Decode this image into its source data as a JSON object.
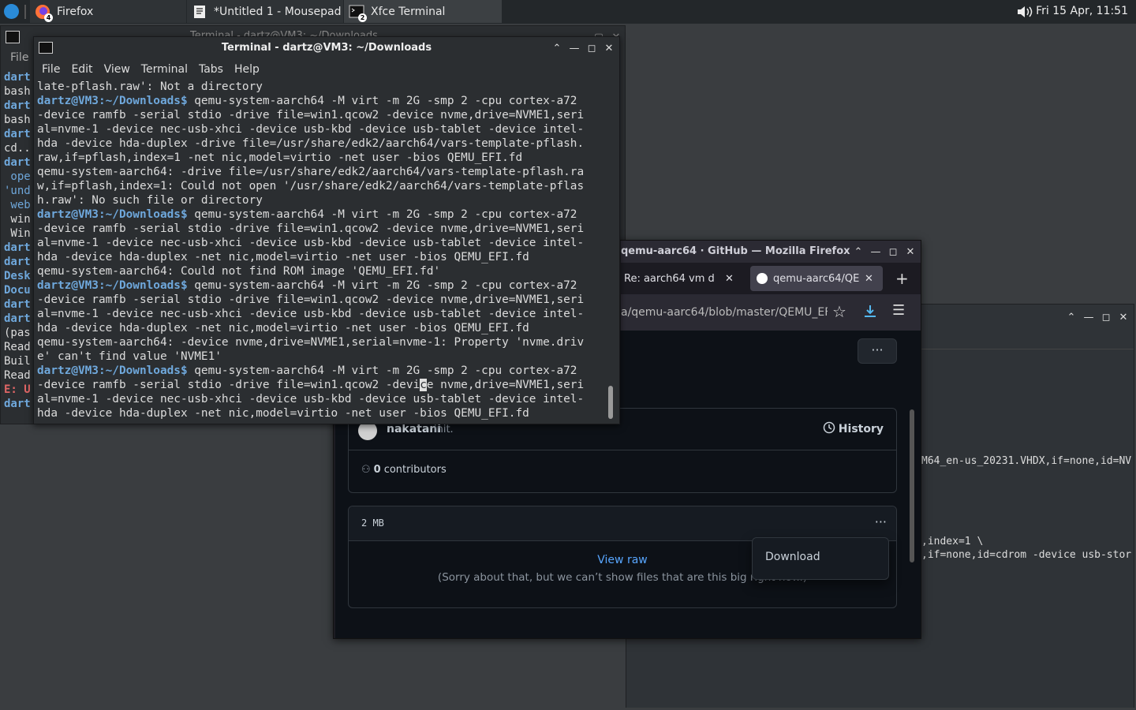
{
  "panel": {
    "tasks": [
      {
        "label": "Firefox",
        "badge": "4"
      },
      {
        "label": "*Untitled 1 - Mousepad",
        "badge": ""
      },
      {
        "label": "Xfce Terminal",
        "badge": "2"
      }
    ],
    "clock": "Fri 15 Apr, 11:51"
  },
  "back_terminal": {
    "title": "Terminal - dartz@VM3: ~/Downloads",
    "menu_first": "File",
    "side_lines": [
      "dart",
      "bash",
      "dart",
      "bash",
      "dart",
      "cd..",
      "dart",
      " ope",
      "'und",
      " web",
      " win",
      " Win",
      "dart",
      "dart",
      "Desk",
      "Docu",
      "dart",
      "dart",
      "(pas",
      "Read",
      "Buil",
      "Read",
      "E: U",
      "dart"
    ]
  },
  "terminal": {
    "title": "Terminal - dartz@VM3: ~/Downloads",
    "menu": [
      "File",
      "Edit",
      "View",
      "Terminal",
      "Tabs",
      "Help"
    ],
    "prompt": "dartz@VM3:~/Downloads$",
    "lines": [
      {
        "t": "late-pflash.raw': Not a directory"
      },
      {
        "p": true,
        "t": " qemu-system-aarch64 -M virt -m 2G -smp 2 -cpu cortex-a72"
      },
      {
        "t": "-device ramfb -serial stdio -drive file=win1.qcow2 -device nvme,drive=NVME1,seri"
      },
      {
        "t": "al=nvme-1 -device nec-usb-xhci -device usb-kbd -device usb-tablet -device intel-"
      },
      {
        "t": "hda -device hda-duplex -drive file=/usr/share/edk2/aarch64/vars-template-pflash."
      },
      {
        "t": "raw,if=pflash,index=1 -net nic,model=virtio -net user -bios QEMU_EFI.fd"
      },
      {
        "t": "qemu-system-aarch64: -drive file=/usr/share/edk2/aarch64/vars-template-pflash.ra"
      },
      {
        "t": "w,if=pflash,index=1: Could not open '/usr/share/edk2/aarch64/vars-template-pflas"
      },
      {
        "t": "h.raw': No such file or directory"
      },
      {
        "p": true,
        "t": " qemu-system-aarch64 -M virt -m 2G -smp 2 -cpu cortex-a72"
      },
      {
        "t": "-device ramfb -serial stdio -drive file=win1.qcow2 -device nvme,drive=NVME1,seri"
      },
      {
        "t": "al=nvme-1 -device nec-usb-xhci -device usb-kbd -device usb-tablet -device intel-"
      },
      {
        "t": "hda -device hda-duplex -net nic,model=virtio -net user -bios QEMU_EFI.fd"
      },
      {
        "t": "qemu-system-aarch64: Could not find ROM image 'QEMU_EFI.fd'"
      },
      {
        "p": true,
        "t": " qemu-system-aarch64 -M virt -m 2G -smp 2 -cpu cortex-a72"
      },
      {
        "t": "-device ramfb -serial stdio -drive file=win1.qcow2 -device nvme,drive=NVME1,seri"
      },
      {
        "t": "al=nvme-1 -device nec-usb-xhci -device usb-kbd -device usb-tablet -device intel-"
      },
      {
        "t": "hda -device hda-duplex -net nic,model=virtio -net user -bios QEMU_EFI.fd"
      },
      {
        "t": "qemu-system-aarch64: -device nvme,drive=NVME1,serial=nvme-1: Property 'nvme.driv"
      },
      {
        "t": "e' can't find value 'NVME1'"
      },
      {
        "p": true,
        "t": " qemu-system-aarch64 -M virt -m 2G -smp 2 -cpu cortex-a72"
      },
      {
        "t": "-device ramfb -serial stdio -drive file=win1.qcow2 -devi",
        "cursor": "c",
        "after": "e nvme,drive=NVME1,seri"
      },
      {
        "t": "al=nvme-1 -device nec-usb-xhci -device usb-kbd -device usb-tablet -device intel-"
      },
      {
        "t": "hda -device hda-duplex -net nic,model=virtio -net user -bios QEMU_EFI.fd"
      }
    ]
  },
  "firefox": {
    "title": "qemu-aarc64 · GitHub — Mozilla Firefox",
    "tabs": [
      {
        "label": "Re: aarch64 vm d"
      },
      {
        "label": "qemu-aarc64/QE"
      }
    ],
    "url": "a/qemu-aarc64/blob/master/QEMU_EF",
    "commit": {
      "author": "nakatani",
      "message": "init.",
      "history": "History"
    },
    "contributors": {
      "count": "0",
      "label": "contributors"
    },
    "file": {
      "size": "2 MB",
      "view_raw": "View raw",
      "note": "(Sorry about that, but we can’t show files that are this big right now.)"
    },
    "menu_item": "Download"
  },
  "mousepad": {
    "lines": [
      "M64_en-us_20231.VHDX,if=none,id=NV",
      "",
      "",
      "",
      "",
      "",
      ",index=1 \\",
      ",if=none,id=cdrom -device usb-stor"
    ]
  }
}
